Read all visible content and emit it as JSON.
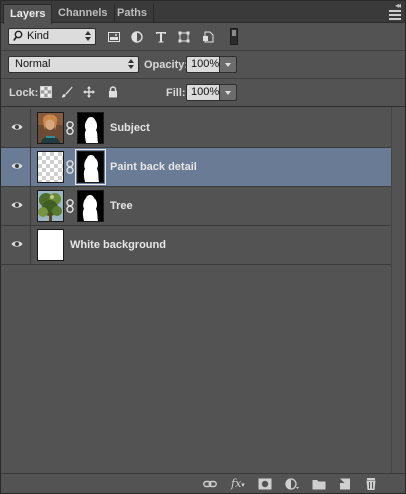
{
  "tabs": [
    {
      "label": "Layers",
      "active": true
    },
    {
      "label": "Channels",
      "active": false
    },
    {
      "label": "Paths",
      "active": false
    }
  ],
  "filter": {
    "kind_label": "Kind",
    "icons": [
      "pixel-filter-icon",
      "adjustment-filter-icon",
      "type-filter-icon",
      "shape-filter-icon",
      "smart-object-filter-icon"
    ]
  },
  "blend": {
    "mode": "Normal",
    "opacity_label": "Opacity:",
    "opacity_value": "100%"
  },
  "lock": {
    "label": "Lock:",
    "icons": [
      "lock-transparent-pixels-icon",
      "lock-image-pixels-icon",
      "lock-position-icon",
      "lock-all-icon"
    ],
    "fill_label": "Fill:",
    "fill_value": "100%"
  },
  "layers": [
    {
      "name": "Subject",
      "visible": true,
      "selected": false,
      "thumb": "photo-person",
      "has_mask": true
    },
    {
      "name": "Paint back detail",
      "visible": true,
      "selected": true,
      "thumb": "transparent",
      "has_mask": true
    },
    {
      "name": "Tree",
      "visible": true,
      "selected": false,
      "thumb": "photo-tree",
      "has_mask": true
    },
    {
      "name": "White background",
      "visible": true,
      "selected": false,
      "thumb": "white",
      "has_mask": false
    }
  ],
  "bottom_icons": [
    "link-layers-icon",
    "fx-icon",
    "add-mask-icon",
    "adjustment-layer-icon",
    "new-group-icon",
    "new-layer-icon",
    "delete-layer-icon"
  ],
  "colors": {
    "panel_bg": "#535353",
    "selection": "#6a7b96",
    "tab_bar": "#3a3a3a"
  }
}
